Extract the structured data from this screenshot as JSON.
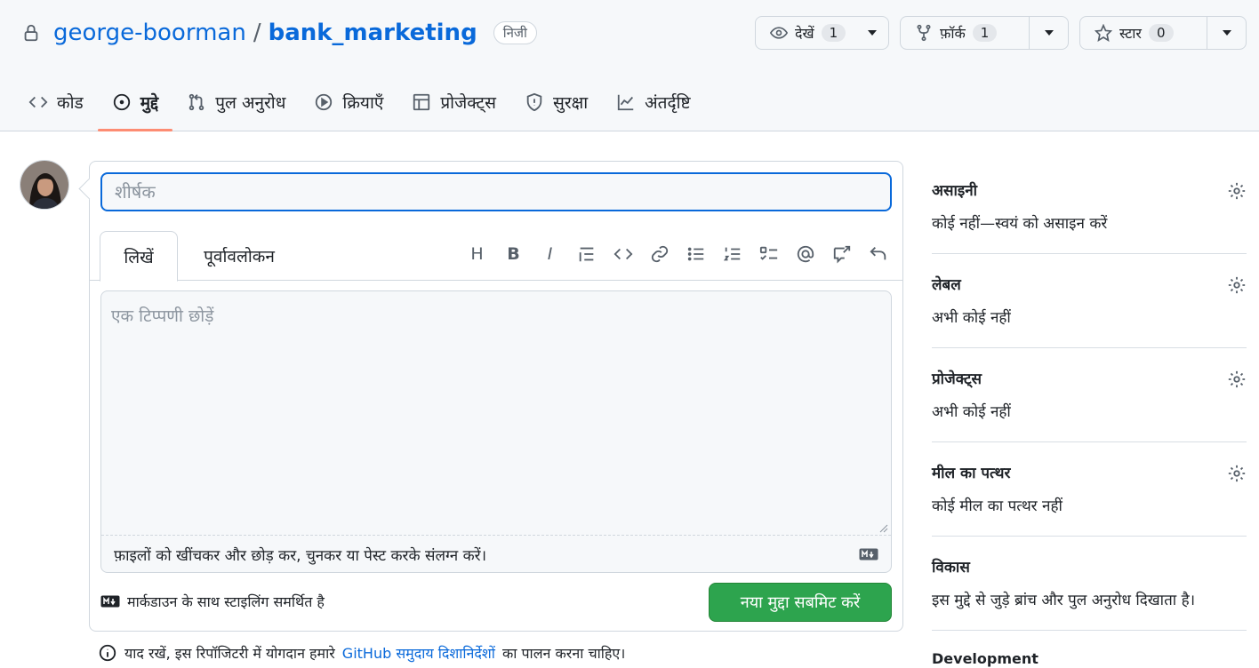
{
  "repo": {
    "owner": "george-boorman",
    "separator": "/",
    "name": "bank_marketing",
    "visibility": "निजी"
  },
  "actions": {
    "watch": {
      "label": "देखें",
      "count": "1"
    },
    "fork": {
      "label": "फ़ॉर्क",
      "count": "1"
    },
    "star": {
      "label": "स्टार",
      "count": "0"
    }
  },
  "nav": {
    "tabs": [
      {
        "label": "कोड",
        "icon": "code-icon"
      },
      {
        "label": "मुद्दे",
        "icon": "issue-icon",
        "active": true
      },
      {
        "label": "पुल अनुरोध",
        "icon": "pull-request-icon"
      },
      {
        "label": "क्रियाएँ",
        "icon": "play-icon"
      },
      {
        "label": "प्रोजेक्ट्स",
        "icon": "table-icon"
      },
      {
        "label": "सुरक्षा",
        "icon": "shield-icon"
      },
      {
        "label": "अंतर्दृष्टि",
        "icon": "graph-icon"
      }
    ]
  },
  "issue_form": {
    "title_placeholder": "शीर्षक",
    "tab_write": "लिखें",
    "tab_preview": "पूर्वावलोकन",
    "toolbar": {
      "heading": "H",
      "bold": "B",
      "italic": "I"
    },
    "comment_placeholder": "एक टिप्पणी छोड़ें",
    "attach_text": "फ़ाइलों को खींचकर और छोड़ कर, चुनकर या पेस्ट करके संलग्न करें।",
    "markdown_note": "मार्कडाउन के साथ स्टाइलिंग समर्थित है",
    "submit_label": "नया मुद्दा सबमिट करें"
  },
  "guidelines": {
    "prefix": "याद रखें, इस रिपॉजिटरी में योगदान हमारे",
    "link": "GitHub समुदाय दिशानिर्देशों",
    "suffix": "का पालन करना चाहिए।"
  },
  "sidebar": {
    "assignees": {
      "heading": "असाइनी",
      "value": "कोई नहीं—स्वयं को असाइन करें"
    },
    "labels": {
      "heading": "लेबल",
      "value": "अभी कोई नहीं"
    },
    "projects": {
      "heading": "प्रोजेक्ट्स",
      "value": "अभी कोई नहीं"
    },
    "milestone": {
      "heading": "मील का पत्थर",
      "value": "कोई मील का पत्थर नहीं"
    },
    "development": {
      "heading": "विकास",
      "value": "इस मुद्दे से जुड़े ब्रांच और पुल अनुरोध दिखाता है।"
    },
    "next_heading": "Development"
  },
  "colors": {
    "accent": "#0969da",
    "submit": "#2da44e",
    "active_tab_underline": "#fd8c73"
  }
}
